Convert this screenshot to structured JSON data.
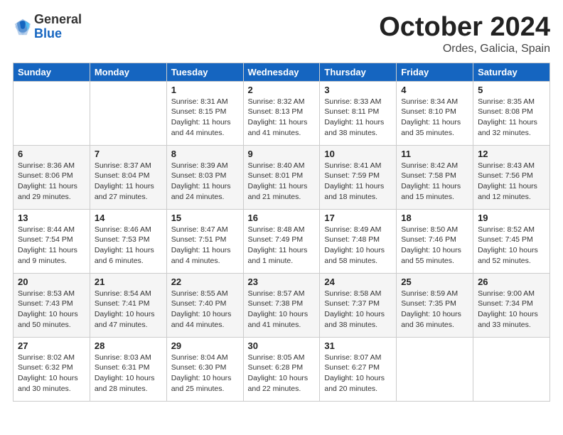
{
  "logo": {
    "general": "General",
    "blue": "Blue"
  },
  "title": "October 2024",
  "location": "Ordes, Galicia, Spain",
  "days_of_week": [
    "Sunday",
    "Monday",
    "Tuesday",
    "Wednesday",
    "Thursday",
    "Friday",
    "Saturday"
  ],
  "weeks": [
    [
      {
        "day": "",
        "sunrise": "",
        "sunset": "",
        "daylight": ""
      },
      {
        "day": "",
        "sunrise": "",
        "sunset": "",
        "daylight": ""
      },
      {
        "day": "1",
        "sunrise": "Sunrise: 8:31 AM",
        "sunset": "Sunset: 8:15 PM",
        "daylight": "Daylight: 11 hours and 44 minutes."
      },
      {
        "day": "2",
        "sunrise": "Sunrise: 8:32 AM",
        "sunset": "Sunset: 8:13 PM",
        "daylight": "Daylight: 11 hours and 41 minutes."
      },
      {
        "day": "3",
        "sunrise": "Sunrise: 8:33 AM",
        "sunset": "Sunset: 8:11 PM",
        "daylight": "Daylight: 11 hours and 38 minutes."
      },
      {
        "day": "4",
        "sunrise": "Sunrise: 8:34 AM",
        "sunset": "Sunset: 8:10 PM",
        "daylight": "Daylight: 11 hours and 35 minutes."
      },
      {
        "day": "5",
        "sunrise": "Sunrise: 8:35 AM",
        "sunset": "Sunset: 8:08 PM",
        "daylight": "Daylight: 11 hours and 32 minutes."
      }
    ],
    [
      {
        "day": "6",
        "sunrise": "Sunrise: 8:36 AM",
        "sunset": "Sunset: 8:06 PM",
        "daylight": "Daylight: 11 hours and 29 minutes."
      },
      {
        "day": "7",
        "sunrise": "Sunrise: 8:37 AM",
        "sunset": "Sunset: 8:04 PM",
        "daylight": "Daylight: 11 hours and 27 minutes."
      },
      {
        "day": "8",
        "sunrise": "Sunrise: 8:39 AM",
        "sunset": "Sunset: 8:03 PM",
        "daylight": "Daylight: 11 hours and 24 minutes."
      },
      {
        "day": "9",
        "sunrise": "Sunrise: 8:40 AM",
        "sunset": "Sunset: 8:01 PM",
        "daylight": "Daylight: 11 hours and 21 minutes."
      },
      {
        "day": "10",
        "sunrise": "Sunrise: 8:41 AM",
        "sunset": "Sunset: 7:59 PM",
        "daylight": "Daylight: 11 hours and 18 minutes."
      },
      {
        "day": "11",
        "sunrise": "Sunrise: 8:42 AM",
        "sunset": "Sunset: 7:58 PM",
        "daylight": "Daylight: 11 hours and 15 minutes."
      },
      {
        "day": "12",
        "sunrise": "Sunrise: 8:43 AM",
        "sunset": "Sunset: 7:56 PM",
        "daylight": "Daylight: 11 hours and 12 minutes."
      }
    ],
    [
      {
        "day": "13",
        "sunrise": "Sunrise: 8:44 AM",
        "sunset": "Sunset: 7:54 PM",
        "daylight": "Daylight: 11 hours and 9 minutes."
      },
      {
        "day": "14",
        "sunrise": "Sunrise: 8:46 AM",
        "sunset": "Sunset: 7:53 PM",
        "daylight": "Daylight: 11 hours and 6 minutes."
      },
      {
        "day": "15",
        "sunrise": "Sunrise: 8:47 AM",
        "sunset": "Sunset: 7:51 PM",
        "daylight": "Daylight: 11 hours and 4 minutes."
      },
      {
        "day": "16",
        "sunrise": "Sunrise: 8:48 AM",
        "sunset": "Sunset: 7:49 PM",
        "daylight": "Daylight: 11 hours and 1 minute."
      },
      {
        "day": "17",
        "sunrise": "Sunrise: 8:49 AM",
        "sunset": "Sunset: 7:48 PM",
        "daylight": "Daylight: 10 hours and 58 minutes."
      },
      {
        "day": "18",
        "sunrise": "Sunrise: 8:50 AM",
        "sunset": "Sunset: 7:46 PM",
        "daylight": "Daylight: 10 hours and 55 minutes."
      },
      {
        "day": "19",
        "sunrise": "Sunrise: 8:52 AM",
        "sunset": "Sunset: 7:45 PM",
        "daylight": "Daylight: 10 hours and 52 minutes."
      }
    ],
    [
      {
        "day": "20",
        "sunrise": "Sunrise: 8:53 AM",
        "sunset": "Sunset: 7:43 PM",
        "daylight": "Daylight: 10 hours and 50 minutes."
      },
      {
        "day": "21",
        "sunrise": "Sunrise: 8:54 AM",
        "sunset": "Sunset: 7:41 PM",
        "daylight": "Daylight: 10 hours and 47 minutes."
      },
      {
        "day": "22",
        "sunrise": "Sunrise: 8:55 AM",
        "sunset": "Sunset: 7:40 PM",
        "daylight": "Daylight: 10 hours and 44 minutes."
      },
      {
        "day": "23",
        "sunrise": "Sunrise: 8:57 AM",
        "sunset": "Sunset: 7:38 PM",
        "daylight": "Daylight: 10 hours and 41 minutes."
      },
      {
        "day": "24",
        "sunrise": "Sunrise: 8:58 AM",
        "sunset": "Sunset: 7:37 PM",
        "daylight": "Daylight: 10 hours and 38 minutes."
      },
      {
        "day": "25",
        "sunrise": "Sunrise: 8:59 AM",
        "sunset": "Sunset: 7:35 PM",
        "daylight": "Daylight: 10 hours and 36 minutes."
      },
      {
        "day": "26",
        "sunrise": "Sunrise: 9:00 AM",
        "sunset": "Sunset: 7:34 PM",
        "daylight": "Daylight: 10 hours and 33 minutes."
      }
    ],
    [
      {
        "day": "27",
        "sunrise": "Sunrise: 8:02 AM",
        "sunset": "Sunset: 6:32 PM",
        "daylight": "Daylight: 10 hours and 30 minutes."
      },
      {
        "day": "28",
        "sunrise": "Sunrise: 8:03 AM",
        "sunset": "Sunset: 6:31 PM",
        "daylight": "Daylight: 10 hours and 28 minutes."
      },
      {
        "day": "29",
        "sunrise": "Sunrise: 8:04 AM",
        "sunset": "Sunset: 6:30 PM",
        "daylight": "Daylight: 10 hours and 25 minutes."
      },
      {
        "day": "30",
        "sunrise": "Sunrise: 8:05 AM",
        "sunset": "Sunset: 6:28 PM",
        "daylight": "Daylight: 10 hours and 22 minutes."
      },
      {
        "day": "31",
        "sunrise": "Sunrise: 8:07 AM",
        "sunset": "Sunset: 6:27 PM",
        "daylight": "Daylight: 10 hours and 20 minutes."
      },
      {
        "day": "",
        "sunrise": "",
        "sunset": "",
        "daylight": ""
      },
      {
        "day": "",
        "sunrise": "",
        "sunset": "",
        "daylight": ""
      }
    ]
  ]
}
